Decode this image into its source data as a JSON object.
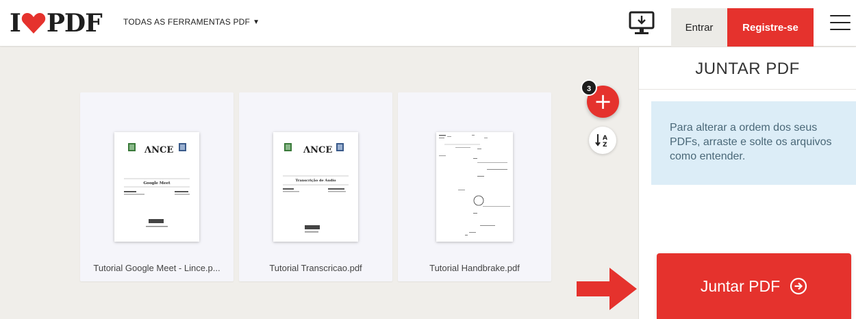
{
  "header": {
    "logo_text_left": "I",
    "logo_text_right": "PDF",
    "tools_menu_label": "TODAS AS FERRAMENTAS PDF",
    "login_label": "Entrar",
    "register_label": "Registre-se",
    "icons": [
      "heart-logo-icon",
      "caret-down-icon",
      "desktop-download-icon",
      "hamburger-menu-icon"
    ]
  },
  "workspace": {
    "file_count": "3",
    "add_symbol": "+",
    "files": [
      {
        "name": "Tutorial Google Meet - Lince.p..."
      },
      {
        "name": "Tutorial Transcricao.pdf"
      },
      {
        "name": "Tutorial Handbrake.pdf"
      }
    ],
    "thumbnails": [
      {
        "heading": "Google Meet"
      },
      {
        "heading": "Transcrição de Áudio"
      },
      {
        "heading": ""
      }
    ]
  },
  "sidebar": {
    "title": "JUNTAR PDF",
    "info_text": "Para alterar a ordem dos seus PDFs, arraste e solte os arquivos como entender.",
    "merge_button_label": "Juntar PDF"
  },
  "colors": {
    "brand_red": "#e5322d",
    "info_bg": "#dcedf7",
    "workspace_bg": "#f0eeea"
  }
}
